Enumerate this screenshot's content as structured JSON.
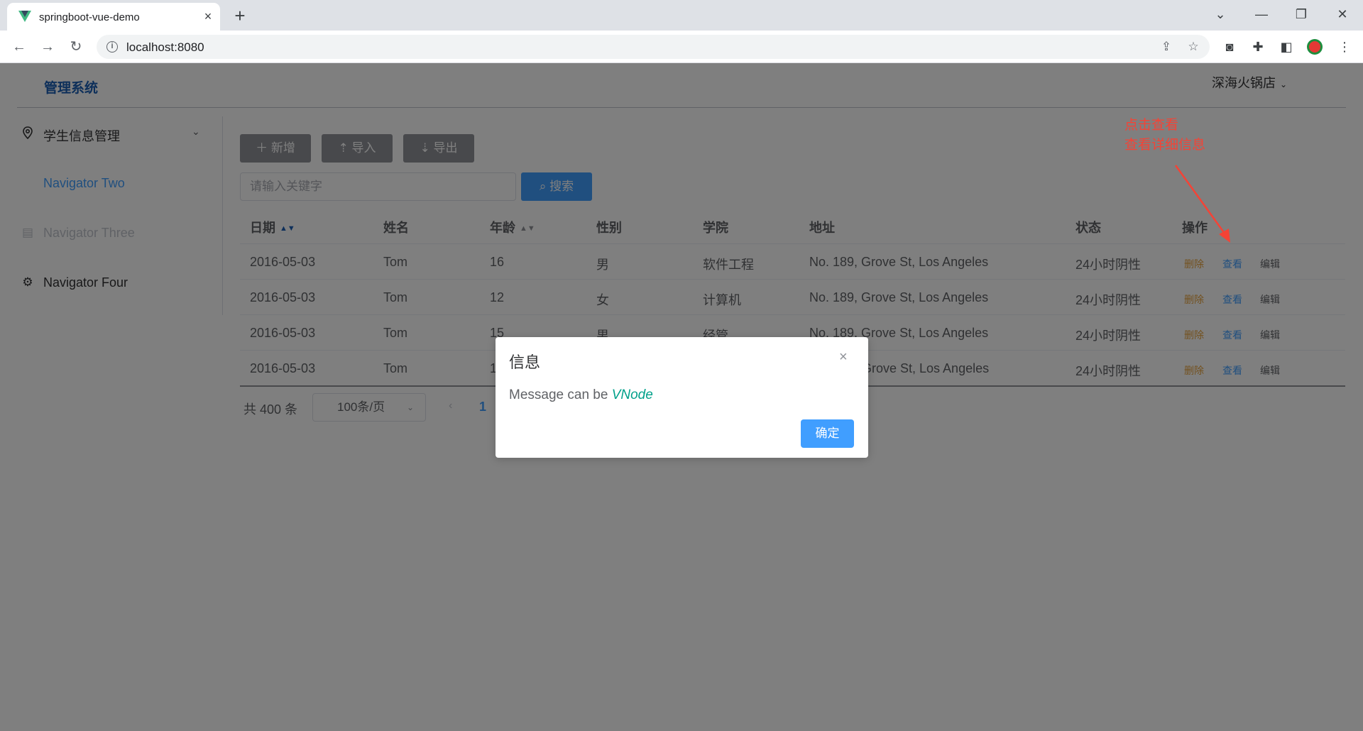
{
  "browser": {
    "tab_title": "springboot-vue-demo",
    "tab_close": "×",
    "new_tab": "+",
    "url": "localhost:8080",
    "window_controls": {
      "chevron": "⌄",
      "minimize": "—",
      "restore": "❐",
      "close": "✕"
    },
    "nav": {
      "back": "←",
      "forward": "→",
      "reload": "↻"
    }
  },
  "header": {
    "logo": "管理系统",
    "user": "深海火锅店",
    "user_chevron": "⌄"
  },
  "sidebar": {
    "items": [
      {
        "label": "学生信息管理",
        "icon": "location-icon",
        "has_submenu": true,
        "color": "#303133"
      },
      {
        "label": "Navigator Two",
        "icon": "",
        "has_submenu": false,
        "color": "#409eff"
      },
      {
        "label": "Navigator Three",
        "icon": "document-icon",
        "has_submenu": false,
        "color": "#c0c4cc"
      },
      {
        "label": "Navigator Four",
        "icon": "gear-icon",
        "has_submenu": false,
        "color": "#303133"
      }
    ]
  },
  "toolbar": {
    "add_label": "＋ 新增",
    "import_label": "⇡ 导入",
    "export_label": "⇣ 导出",
    "search_placeholder": "请输入关键字",
    "search_label": "⌕ 搜索"
  },
  "table": {
    "columns": [
      "日期",
      "姓名",
      "年龄",
      "性别",
      "学院",
      "地址",
      "状态",
      "操作"
    ],
    "sortable_marker": "▲▼",
    "rows": [
      {
        "date": "2016-05-03",
        "name": "Tom",
        "age": "16",
        "sex": "男",
        "college": "软件工程",
        "address": "No. 189, Grove St, Los Angeles",
        "status": "24小时阴性"
      },
      {
        "date": "2016-05-03",
        "name": "Tom",
        "age": "12",
        "sex": "女",
        "college": "计算机",
        "address": "No. 189, Grove St, Los Angeles",
        "status": "24小时阴性"
      },
      {
        "date": "2016-05-03",
        "name": "Tom",
        "age": "15",
        "sex": "男",
        "college": "经管",
        "address": "No. 189, Grove St, Los Angeles",
        "status": "24小时阴性"
      },
      {
        "date": "2016-05-03",
        "name": "Tom",
        "age": "1",
        "sex": "",
        "college": "",
        "address": "Grove St, Los Angeles",
        "status": "24小时阴性"
      }
    ],
    "actions": {
      "delete": "删除",
      "view": "查看",
      "edit": "编辑"
    }
  },
  "pagination": {
    "total": "共 400 条",
    "page_size": "100条/页",
    "prev": "‹",
    "current_page": "1"
  },
  "annotation": {
    "line1": "点击查看",
    "line2": "查看详细信息",
    "color": "#f44336"
  },
  "dialog": {
    "title": "信息",
    "close": "×",
    "message_prefix": "Message can be ",
    "message_emphasis": "VNode",
    "confirm_label": "确定"
  }
}
